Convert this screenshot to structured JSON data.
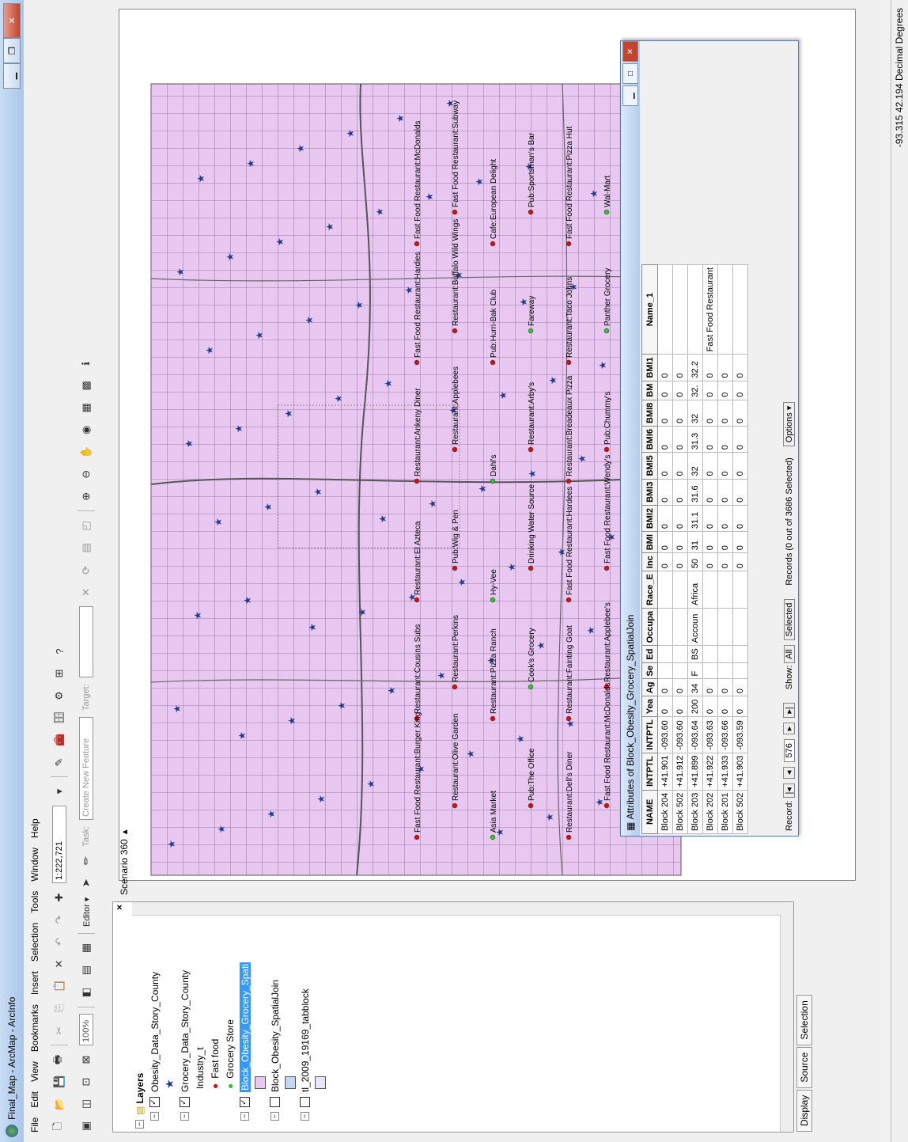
{
  "window": {
    "title": "Final_Map - ArcMap - ArcInfo"
  },
  "menu": [
    "File",
    "Edit",
    "View",
    "Bookmarks",
    "Insert",
    "Selection",
    "Tools",
    "Window",
    "Help"
  ],
  "toolbar": {
    "scale": "1:222,721",
    "zoom": "100%",
    "editor_label": "Editor ▾",
    "task_label": "Task:",
    "task_value": "Create New Feature",
    "target_label": "Target:"
  },
  "toc": {
    "root": "Layers",
    "layers": [
      {
        "name": "Obesity_Data_Story_County",
        "checked": true,
        "symbol": "star"
      },
      {
        "name": "Grocery_Data_Story_County",
        "checked": true,
        "symbol": "none"
      },
      {
        "name": "Industry_t",
        "checked": null,
        "symbol": "none"
      },
      {
        "name": "Fast food",
        "checked": null,
        "symbol": "red-dot"
      },
      {
        "name": "Grocery Store",
        "checked": null,
        "symbol": "green-dot"
      },
      {
        "name": "Block_Obesity_Grocery_Spati",
        "checked": true,
        "symbol": "none",
        "selected": true
      },
      {
        "name": "",
        "checked": null,
        "symbol": "purple-swatch"
      },
      {
        "name": "Block_Obesity_SpatialJoin",
        "checked": false,
        "symbol": "none"
      },
      {
        "name": "",
        "checked": null,
        "symbol": "blue-swatch"
      },
      {
        "name": "tl_2009_19169_tabblock",
        "checked": false,
        "symbol": "none"
      },
      {
        "name": "",
        "checked": null,
        "symbol": "lav-swatch"
      }
    ],
    "tabs": [
      "Display",
      "Source",
      "Selection"
    ]
  },
  "scenario": {
    "label": "Scenario 360"
  },
  "map": {
    "fill_color": "#e8c8f0",
    "labels": [
      "Fast Food Restaurant:Burger King",
      "Restaurant:Cousins Subs",
      "Restaurant:El Azteca",
      "Restaurant:Ankeny Diner",
      "Fast Food Restaurant:Hardies",
      "Fast Food Restaurant:McDonalds",
      "Restaurant:Olive Garden",
      "Restaurant:Perkins",
      "Pub:Wig & Pen",
      "Restaurant:Applebees",
      "Restaurant:Buffalo Wild Wings",
      "Fast Food Restaurant:Subway",
      "Asia Market",
      "Restaurant:Pizza Ranch",
      "Hy-Vee",
      "Dahl's",
      "Pub:Hurri-Bak Club",
      "Cafe:European Delight",
      "Pub:The Office",
      "Cook's Grocery",
      "Drinking Water Source",
      "Restaurant:Arby's",
      "Fareway",
      "Pub:Sportsman's Bar",
      "Restaurant:Dell's Diner",
      "Restaurant:Fainting Goat",
      "Fast Food Restaurant:Hardees",
      "Restaurant:Breadeaux Pizza",
      "Restaurant:Taco Johns",
      "Fast Food Restaurant:Pizza Hut",
      "Fast Food Restaurant:McDonalds",
      "Restaurant:Applebee's",
      "Fast Food Restaurant:Wendy's",
      "Pub:Chummy's",
      "Panther Grocery",
      "Wal-Mart"
    ]
  },
  "attribute_table": {
    "title": "Attributes of Block_Obesity_Grocery_SpatialJoin",
    "columns": [
      "NAME",
      "INTPTL",
      "INTPTL",
      "Yea",
      "Ag",
      "Se",
      "Ed",
      "Occupa",
      "Race_E",
      "Inc",
      "BMI",
      "BMI2",
      "BMI3",
      "BMI5",
      "BMI6",
      "BMI8",
      "BM",
      "BMI1",
      "Name_1"
    ],
    "rows": [
      [
        "Block 204",
        "+41.901",
        "-093.60",
        "0",
        "0",
        "",
        "",
        "",
        "",
        "0",
        "0",
        "0",
        "0",
        "0",
        "0",
        "0",
        "0",
        "0",
        ""
      ],
      [
        "Block 502",
        "+41.912",
        "-093.60",
        "0",
        "0",
        "",
        "",
        "",
        "",
        "0",
        "0",
        "0",
        "0",
        "0",
        "0",
        "0",
        "0",
        "0",
        ""
      ],
      [
        "Block 203",
        "+41.899",
        "-093.64",
        "200",
        "34",
        "F",
        "BS",
        "Accoun",
        "Africa",
        "50",
        "31",
        "31.1",
        "31.6",
        "32",
        "31.3",
        "32",
        "32.",
        "32.2",
        ""
      ],
      [
        "Block 202",
        "+41.922",
        "-093.63",
        "0",
        "0",
        "",
        "",
        "",
        "",
        "0",
        "0",
        "0",
        "0",
        "0",
        "0",
        "0",
        "0",
        "0",
        "Fast Food Restaurant"
      ],
      [
        "Block 201",
        "+41.933",
        "-093.66",
        "0",
        "0",
        "",
        "",
        "",
        "",
        "0",
        "0",
        "0",
        "0",
        "0",
        "0",
        "0",
        "0",
        "0",
        ""
      ],
      [
        "Block 502",
        "+41.903",
        "-093.59",
        "0",
        "0",
        "",
        "",
        "",
        "",
        "0",
        "0",
        "0",
        "0",
        "0",
        "0",
        "0",
        "0",
        "0",
        ""
      ]
    ],
    "record_label": "Record:",
    "record_value": "576",
    "show_label": "Show:",
    "all_button": "All",
    "selected_button": "Selected",
    "records_text": "Records (0 out of 3686 Selected)",
    "options_button": "Options ▾"
  },
  "statusbar": {
    "coords": "-93.315  42.194 Decimal Degrees"
  }
}
